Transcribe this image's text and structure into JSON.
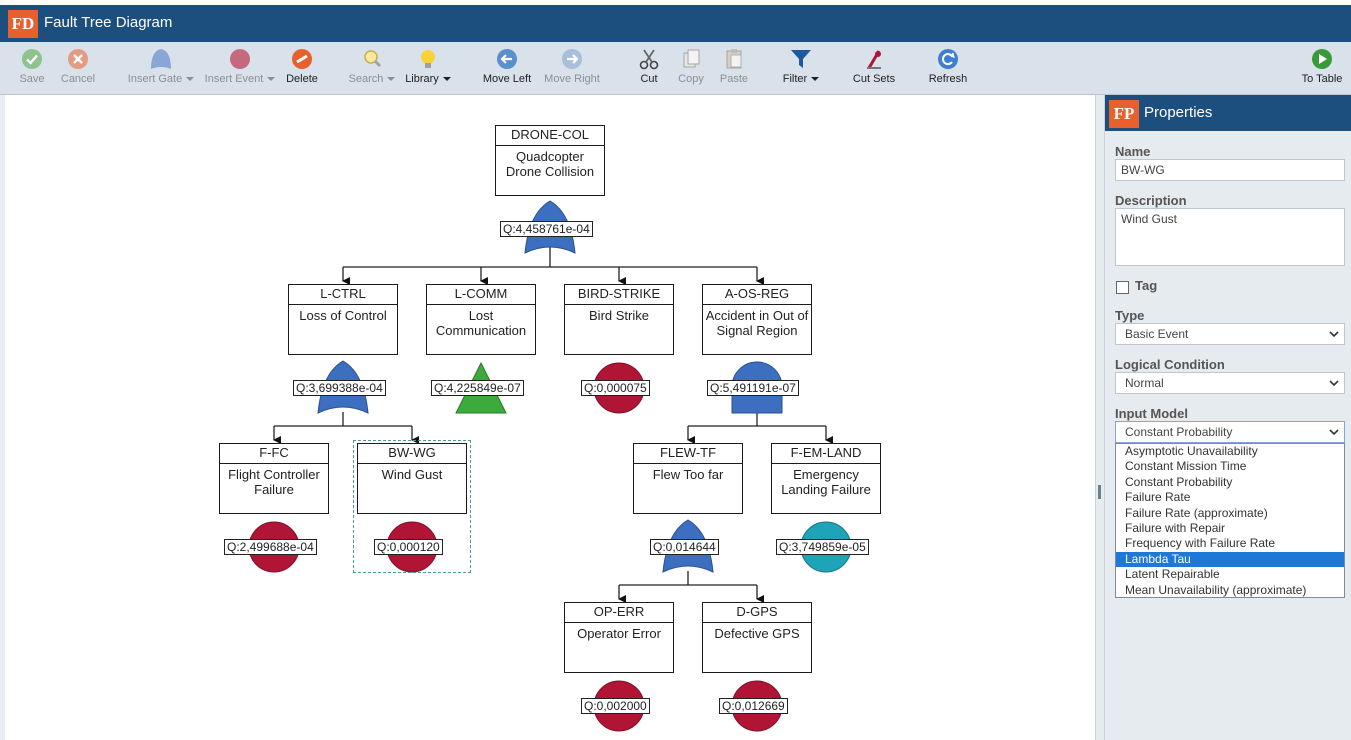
{
  "app": {
    "logo": "FD",
    "title": "Fault Tree Diagram"
  },
  "toolbar": {
    "save": "Save",
    "cancel": "Cancel",
    "insert_gate": "Insert Gate",
    "insert_event": "Insert Event",
    "delete": "Delete",
    "search": "Search",
    "library": "Library",
    "move_left": "Move Left",
    "move_right": "Move Right",
    "cut": "Cut",
    "copy": "Copy",
    "paste": "Paste",
    "filter": "Filter",
    "cut_sets": "Cut Sets",
    "refresh": "Refresh",
    "to_table": "To Table"
  },
  "properties": {
    "logo": "FP",
    "title": "Properties",
    "name_label": "Name",
    "name_value": "BW-WG",
    "description_label": "Description",
    "description_value": "Wind Gust",
    "tag_label": "Tag",
    "type_label": "Type",
    "type_value": "Basic Event",
    "logical_condition_label": "Logical Condition",
    "logical_condition_value": "Normal",
    "input_model_label": "Input Model",
    "input_model_value": "Constant Probability",
    "input_model_options": [
      "Asymptotic Unavailability",
      "Constant Mission Time",
      "Constant Probability",
      "Failure Rate",
      "Failure Rate (approximate)",
      "Failure with Repair",
      "Frequency with Failure Rate",
      "Lambda Tau",
      "Latent Repairable",
      "Mean Unavailability (approximate)"
    ],
    "highlighted_option": "Lambda Tau"
  },
  "tree": {
    "nodes": {
      "drone_col": {
        "id": "DRONE-COL",
        "desc1": "Quadcopter",
        "desc2": "Drone Collision",
        "q": "Q:4,458761e-04",
        "symbol": "or-gate"
      },
      "l_ctrl": {
        "id": "L-CTRL",
        "desc1": "Loss of Control",
        "desc2": "",
        "q": "Q:3,699388e-04",
        "symbol": "or-gate"
      },
      "l_comm": {
        "id": "L-COMM",
        "desc1": "Lost",
        "desc2": "Communication",
        "q": "Q:4,225849e-07",
        "symbol": "transfer-triangle"
      },
      "bird_strike": {
        "id": "BIRD-STRIKE",
        "desc1": "Bird Strike",
        "desc2": "",
        "q": "Q:0,000075",
        "symbol": "basic-event"
      },
      "a_os_reg": {
        "id": "A-OS-REG",
        "desc1": "Accident in Out of",
        "desc2": "Signal Region",
        "q": "Q:5,491191e-07",
        "symbol": "and-gate"
      },
      "f_fc": {
        "id": "F-FC",
        "desc1": "Flight Controller",
        "desc2": "Failure",
        "q": "Q:2,499688e-04",
        "symbol": "basic-event"
      },
      "bw_wg": {
        "id": "BW-WG",
        "desc1": "Wind Gust",
        "desc2": "",
        "q": "Q:0,000120",
        "symbol": "basic-event"
      },
      "flew_tf": {
        "id": "FLEW-TF",
        "desc1": "Flew Too far",
        "desc2": "",
        "q": "Q:0,014644",
        "symbol": "or-gate"
      },
      "f_em_land": {
        "id": "F-EM-LAND",
        "desc1": "Emergency",
        "desc2": "Landing Failure",
        "q": "Q:3,749859e-05",
        "symbol": "basic-event"
      },
      "op_err": {
        "id": "OP-ERR",
        "desc1": "Operator Error",
        "desc2": "",
        "q": "Q:0,002000",
        "symbol": "basic-event"
      },
      "d_gps": {
        "id": "D-GPS",
        "desc1": "Defective GPS",
        "desc2": "",
        "q": "Q:0,012669",
        "symbol": "basic-event"
      }
    },
    "selected_node": "BW-WG"
  },
  "colors": {
    "header": "#1c4f7e",
    "logo": "#e8612c",
    "toolbar": "#d9e2ea",
    "gate": "#3d6fc0",
    "basic_event": "#b01535",
    "basic_event_undeveloped": "#1fa3b8",
    "transfer": "#3daa3d",
    "dropdown_highlight": "#1e78d8"
  }
}
